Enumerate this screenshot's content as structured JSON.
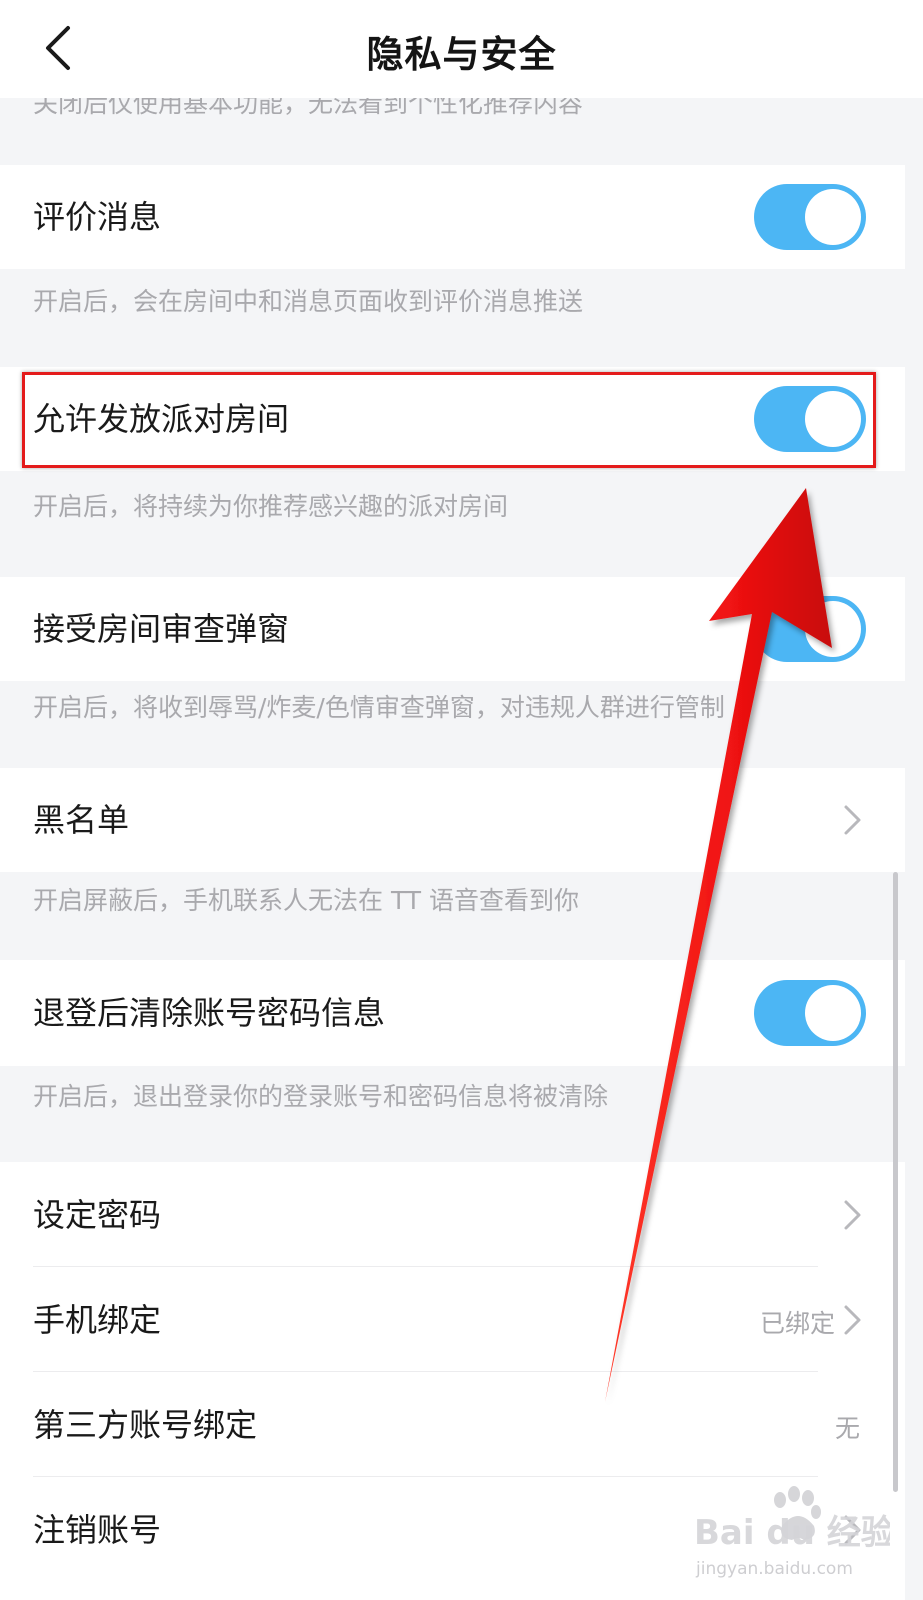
{
  "header": {
    "title": "隐私与安全",
    "back_icon": "chevron-left-icon"
  },
  "settings": {
    "personalized_desc": "关闭后仅使用基本功能，无法看到个性化推荐内容",
    "review_message": {
      "label": "评价消息",
      "enabled": true,
      "desc": "开启后，会在房间中和消息页面收到评价消息推送"
    },
    "party_room": {
      "label": "允许发放派对房间",
      "enabled": true,
      "desc": "开启后，将持续为你推荐感兴趣的派对房间"
    },
    "review_popup": {
      "label": "接受房间审查弹窗",
      "enabled": true,
      "desc": "开启后，将收到辱骂/炸麦/色情审查弹窗，对违规人群进行管制"
    },
    "blacklist": {
      "label": "黑名单",
      "desc": "开启屏蔽后，手机联系人无法在 TT 语音查看到你"
    },
    "clear_on_logout": {
      "label": "退登后清除账号密码信息",
      "enabled": true,
      "desc": "开启后，退出登录你的登录账号和密码信息将被清除"
    },
    "set_password": {
      "label": "设定密码"
    },
    "phone_binding": {
      "label": "手机绑定",
      "value": "已绑定"
    },
    "third_party": {
      "label": "第三方账号绑定",
      "value": "无"
    },
    "cancel_account": {
      "label": "注销账号"
    }
  },
  "colors": {
    "toggle_on": "#4cb6f4",
    "annotation": "#e41b1b"
  },
  "watermark": {
    "brand": "Bai du 经验",
    "url": "jingyan.baidu.com"
  }
}
